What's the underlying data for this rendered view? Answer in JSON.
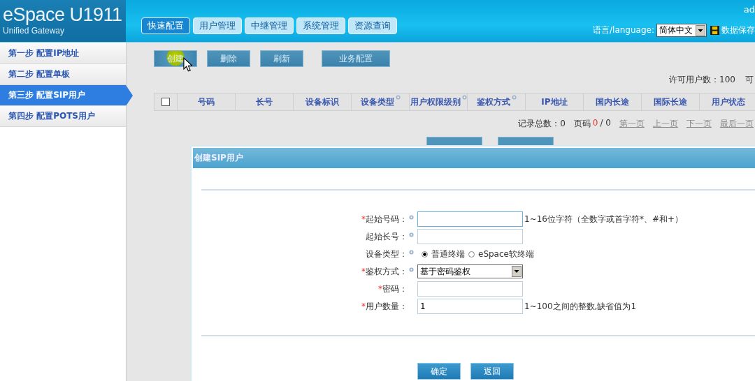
{
  "header": {
    "logo_title": "eSpace U1911",
    "logo_subtitle": "Unified Gateway",
    "user": "ad",
    "language_label": "语言/language:",
    "language_value": "简体中文",
    "save_label": "数据保存"
  },
  "nav_tabs": [
    {
      "label": "快速配置",
      "selected": true
    },
    {
      "label": "用户管理",
      "selected": false
    },
    {
      "label": "中继管理",
      "selected": false
    },
    {
      "label": "系统管理",
      "selected": false
    },
    {
      "label": "资源查询",
      "selected": false
    }
  ],
  "sidebar": {
    "items": [
      {
        "label": "第一步 配置IP地址",
        "selected": false
      },
      {
        "label": "第二步 配置单板",
        "selected": false
      },
      {
        "label": "第三步 配置SIP用户",
        "selected": true
      },
      {
        "label": "第四步 配置POTS用户",
        "selected": false
      }
    ]
  },
  "toolbar": [
    {
      "label": "创建",
      "hovered": true
    },
    {
      "label": "删除",
      "hovered": false
    },
    {
      "label": "刷新",
      "hovered": false
    },
    {
      "label": "业务配置",
      "hovered": false
    }
  ],
  "license_info": [
    "许可用户数：100",
    "可"
  ],
  "table": {
    "columns": [
      {
        "label": "号码",
        "help": false
      },
      {
        "label": "长号",
        "help": false
      },
      {
        "label": "设备标识",
        "help": false
      },
      {
        "label": "设备类型",
        "help": true
      },
      {
        "label": "用户权限级别",
        "help": true
      },
      {
        "label": "鉴权方式",
        "help": true
      },
      {
        "label": "IP地址",
        "help": false
      },
      {
        "label": "国内长途",
        "help": false
      },
      {
        "label": "国际长途",
        "help": false
      },
      {
        "label": "用户状态",
        "help": false
      }
    ],
    "select_all": false
  },
  "pagination": {
    "total": "记录总数：0",
    "page_label": "页码",
    "page_current": "0",
    "page_total": "/ 0",
    "links": [
      "第一页",
      "上一页",
      "下一页",
      "最后一页"
    ]
  },
  "dialog": {
    "title": "创建SIP用户",
    "fields": [
      {
        "kind": "text",
        "label": "起始号码：",
        "required_mark": "*",
        "help": true,
        "focused": true,
        "hint": "1~16位字符（全数字或首字符*、#和+）"
      },
      {
        "kind": "text",
        "label": "起始长号：",
        "help": true,
        "focused": false
      },
      {
        "kind": "radio",
        "label": "设备类型：",
        "help": true,
        "options": [
          {
            "label": "普通终端",
            "selected": true
          },
          {
            "label": "eSpace软终端",
            "selected": false
          }
        ]
      },
      {
        "kind": "select",
        "label": "鉴权方式：",
        "required_mark": "*",
        "help": true,
        "value": "基于密码鉴权"
      },
      {
        "kind": "text",
        "label": "密码：",
        "required_mark": "*",
        "help": false,
        "focused": false
      },
      {
        "kind": "text",
        "label": "用户数量：",
        "required_mark": "*",
        "help": false,
        "value": "1",
        "focused": false,
        "hint": "1~100之间的整数,缺省值为1"
      }
    ],
    "buttons": [
      "确定",
      "返回"
    ]
  }
}
